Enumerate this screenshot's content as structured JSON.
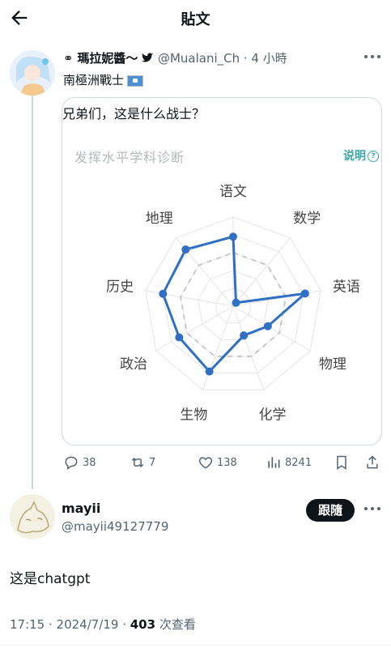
{
  "topbar": {
    "title": "貼文"
  },
  "post1": {
    "author_name": "瑪拉妮醬～",
    "handle_time": "@Mualani_Ch · 4 小時",
    "subtitle": "南極洲戰士",
    "caption": "兄弟们，这是什么战士？",
    "card_title": "发挥水平学科诊断",
    "explain": "说明",
    "explain_q": "?",
    "stats": {
      "replies": "38",
      "reposts": "7",
      "likes": "138",
      "views": "8241"
    }
  },
  "chart_data": {
    "type": "radar",
    "categories": [
      "语文",
      "数学",
      "英语",
      "物理",
      "化学",
      "生物",
      "政治",
      "历史",
      "地理"
    ],
    "series": [
      {
        "values": [
          0.78,
          0.05,
          0.82,
          0.45,
          0.35,
          0.78,
          0.7,
          0.8,
          0.83
        ]
      }
    ],
    "rlim": [
      0,
      1
    ],
    "colors": {
      "line": "#2f6fc4",
      "grid": "#e5e5e5",
      "ring": "#c8c8c8"
    }
  },
  "post2": {
    "author_name": "mayii",
    "handle": "@mayii49127779",
    "follow_label": "跟隨",
    "text": "这是chatgpt",
    "time_date": "17:15 · 2024/7/19 · ",
    "views_count": "403",
    "views_label": " 次查看"
  }
}
